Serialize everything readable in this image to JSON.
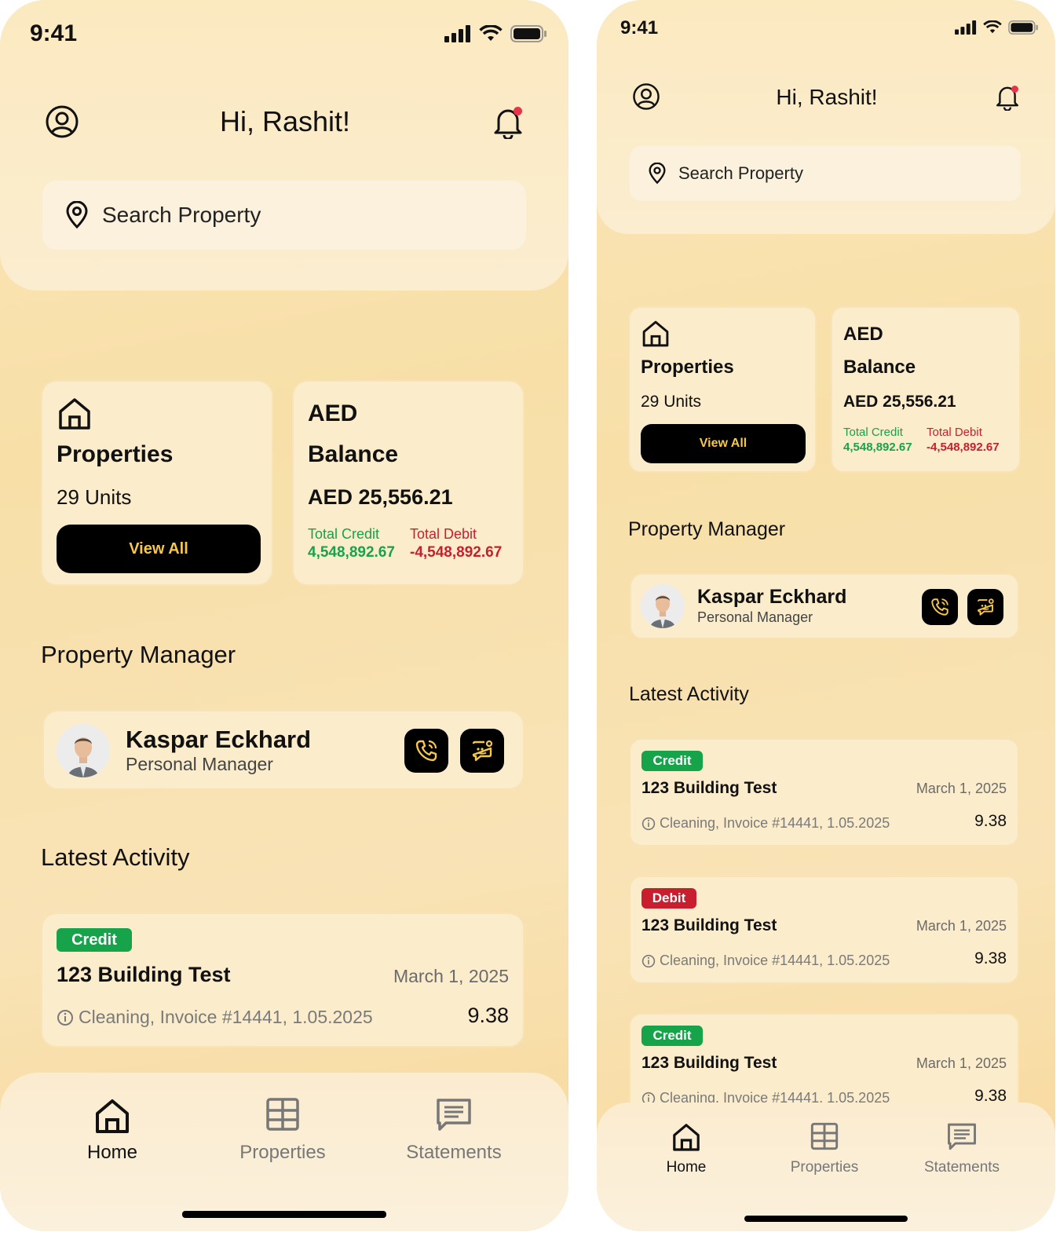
{
  "status": {
    "time": "9:41"
  },
  "header": {
    "greeting": "Hi, Rashit!"
  },
  "search": {
    "placeholder": "Search Property"
  },
  "properties_card": {
    "title": "Properties",
    "units": "29 Units",
    "button": "View All"
  },
  "balance_card": {
    "currency": "AED",
    "title": "Balance",
    "amount": "AED 25,556.21",
    "credit_label": "Total Credit",
    "credit_value": "4,548,892.67",
    "debit_label": "Total Debit",
    "debit_value": "-4,548,892.67"
  },
  "manager_section": {
    "title": "Property Manager",
    "name": "Kaspar Eckhard",
    "role": "Personal Manager"
  },
  "activity_section": {
    "title": "Latest Activity"
  },
  "activities": [
    {
      "type": "Credit",
      "title": "123 Building Test",
      "date": "March 1, 2025",
      "desc": "Cleaning, Invoice #14441, 1.05.2025",
      "amount": "9.38"
    },
    {
      "type": "Debit",
      "title": "123 Building Test",
      "date": "March 1, 2025",
      "desc": "Cleaning, Invoice #14441, 1.05.2025",
      "amount": "9.38"
    },
    {
      "type": "Credit",
      "title": "123 Building Test",
      "date": "March 1, 2025",
      "desc": "Cleaning, Invoice #14441, 1.05.2025",
      "amount": "9.38"
    }
  ],
  "tabs": [
    {
      "label": "Home",
      "icon": "home-icon",
      "active": true
    },
    {
      "label": "Properties",
      "icon": "grid-icon",
      "active": false
    },
    {
      "label": "Statements",
      "icon": "message-icon",
      "active": false
    }
  ],
  "colors": {
    "credit": "#16a34a",
    "debit": "#c81e2e",
    "button_text": "#f6c84a",
    "notification_dot": "#e8334a"
  }
}
